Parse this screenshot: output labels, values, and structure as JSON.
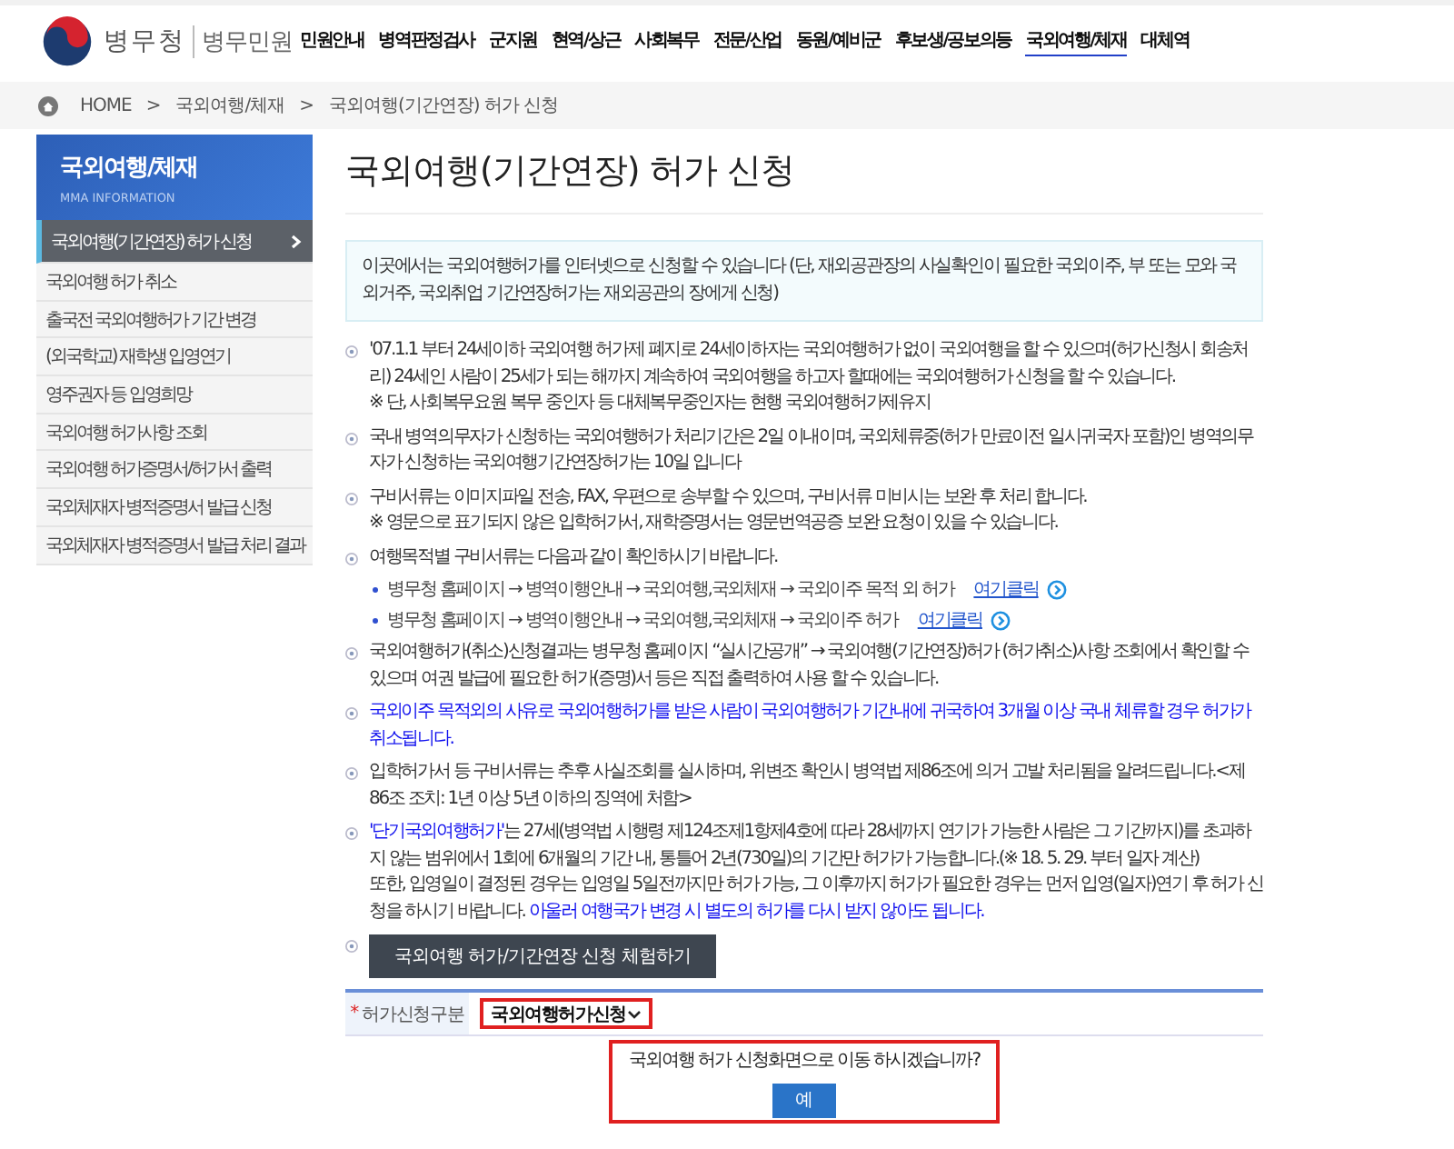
{
  "header": {
    "logo_name": "병무청",
    "logo_sub": "병무민원",
    "nav": [
      {
        "label": "민원안내",
        "selected": false
      },
      {
        "label": "병역판정검사",
        "selected": false
      },
      {
        "label": "군지원",
        "selected": false
      },
      {
        "label": "현역/상근",
        "selected": false
      },
      {
        "label": "사회복무",
        "selected": false
      },
      {
        "label": "전문/산업",
        "selected": false
      },
      {
        "label": "동원/예비군",
        "selected": false
      },
      {
        "label": "후보생/공보의등",
        "selected": false
      },
      {
        "label": "국외여행/체재",
        "selected": true
      },
      {
        "label": "대체역",
        "selected": false
      }
    ]
  },
  "breadcrumb": [
    {
      "label": "HOME"
    },
    {
      "separator": ">",
      "label": "국외여행/체재"
    },
    {
      "separator": ">",
      "label": "국외여행(기간연장) 허가 신청"
    }
  ],
  "sidebar": {
    "title": "국외여행/체재",
    "subtitle": "MMA INFORMATION",
    "items": [
      {
        "label": "국외여행(기간연장) 허가 신청",
        "selected": true
      },
      {
        "label": "국외여행 허가 취소",
        "selected": false
      },
      {
        "label": "출국전 국외여행허가 기간 변경",
        "selected": false
      },
      {
        "label": "(외국학교) 재학생 입영연기",
        "selected": false
      },
      {
        "label": "영주권자 등 입영희망",
        "selected": false
      },
      {
        "label": "국외여행 허가사항 조회",
        "selected": false
      },
      {
        "label": "국외여행 허가증명서/허가서 출력",
        "selected": false
      },
      {
        "label": "국외체재자 병적증명서 발급 신청",
        "selected": false
      },
      {
        "label": "국외체재자 병적증명서 발급 처리 결과",
        "selected": false
      }
    ]
  },
  "page": {
    "title": "국외여행(기간연장) 허가 신청",
    "notice": "이곳에서는 국외여행허가를 인터넷으로 신청할 수 있습니다 (단, 재외공관장의 사실확인이 필요한 국외이주, 부 또는 모와 국외거주, 국외취업 기간연장허가는 재외공관의 장에게 신청)",
    "bullets": [
      {
        "kind": "text",
        "paragraphs": [
          [
            {
              "text": "'07.1.1 부터 24세이하 국외여행 허가제 폐지로 24세이하자는 국외여행허가 없이 국외여행을 할 수 있으며(허가신청시 회송처리) 24세인 사람이 25세가 되는 해까지 계속하여 국외여행을 하고자 할때에는 국외여행허가 신청을 할 수 있습니다.",
              "highlight": false
            }
          ],
          [
            {
              "text": "※ 단, 사회복무요원 복무 중인자 등 대체복무중인자는 현행 국외여행허가제유지",
              "highlight": false
            }
          ]
        ]
      },
      {
        "kind": "text",
        "paragraphs": [
          [
            {
              "text": "국내 병역의무자가 신청하는 국외여행허가 처리기간은 2일 이내이며, 국외체류중(허가 만료이전 일시귀국자 포함)인 병역의무자가 신청하는 국외여행기간연장허가는 10일 입니다",
              "highlight": false
            }
          ]
        ]
      },
      {
        "kind": "text",
        "paragraphs": [
          [
            {
              "text": "구비서류는 이미지파일 전송, FAX, 우편으로 송부할 수 있으며, 구비서류 미비시는 보완 후 처리 합니다.",
              "highlight": false
            }
          ],
          [
            {
              "text": "※ 영문으로 표기되지 않은 입학허가서, 재학증명서는 영문번역공증 보완 요청이 있을 수 있습니다.",
              "highlight": false
            }
          ]
        ]
      },
      {
        "kind": "text",
        "paragraphs": [
          [
            {
              "text": "여행목적별 구비서류는 다음과 같이 확인하시기 바랍니다.",
              "highlight": false
            }
          ]
        ],
        "sub_items": [
          {
            "text": "병무청 홈페이지 → 병역이행안내 → 국외여행,국외체재 → 국외이주 목적 외 허가",
            "link": "여기클릭"
          },
          {
            "text": "병무청 홈페이지 → 병역이행안내 → 국외여행,국외체재 → 국외이주 허가",
            "link": "여기클릭"
          }
        ]
      },
      {
        "kind": "text",
        "paragraphs": [
          [
            {
              "text": "국외여행허가(취소)신청결과는 병무청 홈페이지 “실시간공개” → 국외여행(기간연장)허가 (허가취소)사항 조회에서 확인할 수 있으며 여권 발급에 필요한 허가(증명)서 등은 직접 출력하여 사용 할 수 있습니다.",
              "highlight": false
            }
          ]
        ]
      },
      {
        "kind": "text",
        "paragraphs": [
          [
            {
              "text": "국외이주 목적외의 사유로 국외여행허가를 받은 사람이 국외여행허가 기간내에 귀국하여 3개월 이상 국내 체류할 경우 허가가 취소됩니다.",
              "highlight": true
            }
          ]
        ]
      },
      {
        "kind": "text",
        "paragraphs": [
          [
            {
              "text": "입학허가서 등 구비서류는 추후 사실조회를 실시하며, 위변조 확인시 병역법 제86조에 의거 고발 처리됨을 알려드립니다.<제86조 조치: 1년 이상 5년 이하의 징역에 처함>",
              "highlight": false
            }
          ]
        ]
      },
      {
        "kind": "text",
        "paragraphs": [
          [
            {
              "text": "'단기국외여행허가'",
              "highlight": true
            },
            {
              "text": "는 27세(병역법 시행령 제124조제1항제4호에 따라 28세까지 연기가 가능한 사람은 그 기간까지)를 초과하지 않는 범위에서 1회에 6개월의 기간 내, 통틀어 2년(730일)의 기간만 허가가 가능합니다.(※ 18. 5. 29. 부터 일자 계산)",
              "highlight": false
            }
          ],
          [
            {
              "text": "또한, 입영일이 결정된 경우는 입영일 5일전까지만 허가 가능, 그 이후까지 허가가 필요한 경우는 먼저 입영(일자)연기 후 허가 신청을 하시기 바랍니다. ",
              "highlight": false
            },
            {
              "text": "아울러 여행국가 변경 시 별도의 허가를 다시 받지 않아도 됩니다.",
              "highlight": true
            }
          ]
        ]
      },
      {
        "kind": "button",
        "label": "국외여행 허가/기간연장 신청 체험하기"
      }
    ],
    "form": {
      "required_mark": "*",
      "label": "허가신청구분",
      "value": "국외여행허가신청"
    },
    "dialog": {
      "message": "국외여행 허가 신청화면으로 이동 하시겠습니까?",
      "button": "예"
    }
  }
}
